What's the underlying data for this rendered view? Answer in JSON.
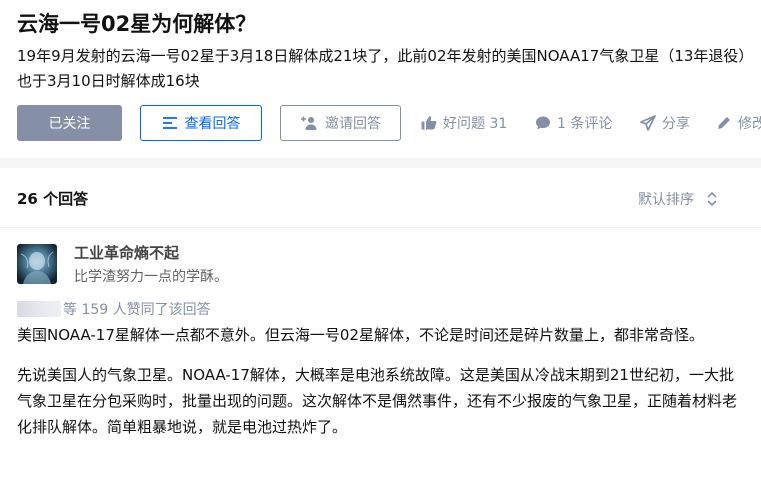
{
  "question": {
    "title": "云海一号02星为何解体？",
    "detail": "19年9月发射的云海一号02星于3月18日解体成21块了，此前02年发射的美国NOAA17气象卫星（13年退役）也于3月10日时解体成16块",
    "buttons": {
      "followed": "已关注",
      "view_answers": "查看回答",
      "invite": "邀请回答"
    },
    "actions": {
      "good_question": "好问题 31",
      "comments": "1 条评论",
      "share": "分享",
      "edit": "修改"
    }
  },
  "answers": {
    "count_label": "26 个回答",
    "sort_label": "默认排序"
  },
  "answer": {
    "author_name": "工业革命熵不起",
    "author_bio": "比学渣努力一点的学酥。",
    "voters_text": "等 159 人赞同了该回答",
    "paragraphs": [
      "美国NOAA-17星解体一点都不意外。但云海一号02星解体，不论是时间还是碎片数量上，都非常奇怪。",
      "先说美国人的气象卫星。NOAA-17解体，大概率是电池系统故障。这是美国从冷战末期到21世纪初，一大批气象卫星在分包采购时，批量出现的问题。这次解体不是偶然事件，还有不少报废的气象卫星，正随着材料老化排队解体。简单粗暴地说，就是电池过热炸了。"
    ]
  },
  "colors": {
    "accent": "#0066ff",
    "muted": "#8590a6",
    "followed_bg": "#8590a6"
  }
}
